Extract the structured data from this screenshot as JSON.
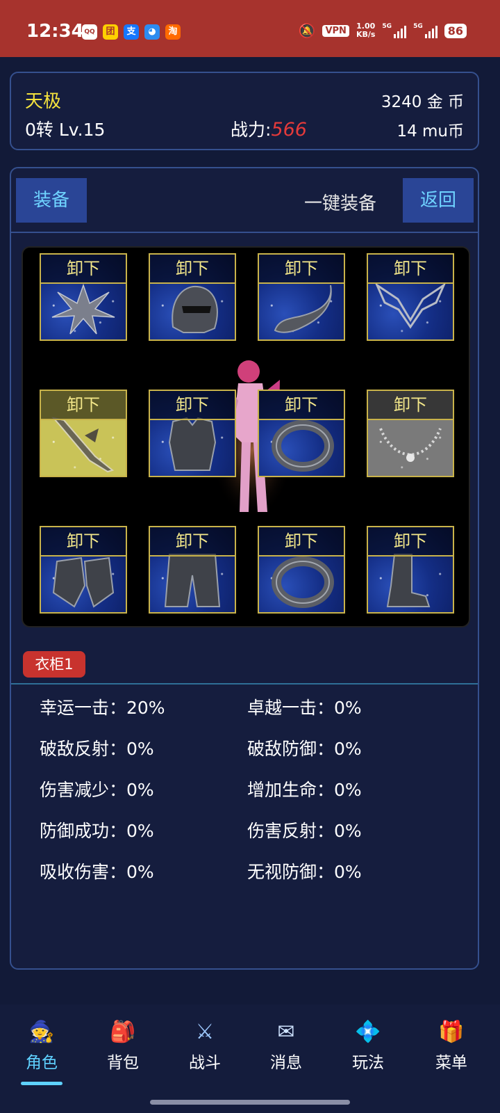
{
  "status_bar": {
    "time": "12:34",
    "app_icons": [
      "QQ",
      "团",
      "支",
      "◕",
      "淘"
    ],
    "vpn": "VPN",
    "speed_top": "1.00",
    "speed_unit": "KB/s",
    "network1": "5G",
    "network2": "5G",
    "battery": "86"
  },
  "player": {
    "name": "天极",
    "level": "0转 Lv.15",
    "power_label": "战力:",
    "power_value": "566",
    "gold": "3240 金  币",
    "mu": "14 mu币"
  },
  "toolbar": {
    "equip_tab": "装备",
    "one_key": "一键装备",
    "back": "返回"
  },
  "slots": [
    {
      "label": "卸下",
      "item": "star-weapon"
    },
    {
      "label": "卸下",
      "item": "helmet"
    },
    {
      "label": "卸下",
      "item": "pendant"
    },
    {
      "label": "卸下",
      "item": "wings"
    },
    {
      "label": "卸下",
      "item": "sword"
    },
    {
      "label": "卸下",
      "item": "armor"
    },
    {
      "label": "卸下",
      "item": "ring"
    },
    {
      "label": "卸下",
      "item": "necklace"
    },
    {
      "label": "卸下",
      "item": "gloves"
    },
    {
      "label": "卸下",
      "item": "pants"
    },
    {
      "label": "卸下",
      "item": "ring"
    },
    {
      "label": "卸下",
      "item": "boots"
    }
  ],
  "wardrobe": "衣柜1",
  "stats": [
    {
      "text": "幸运一击：20%"
    },
    {
      "text": "卓越一击：0%"
    },
    {
      "text": "破敌反射：0%"
    },
    {
      "text": "破敌防御：0%"
    },
    {
      "text": "伤害减少：0%"
    },
    {
      "text": "增加生命：0%"
    },
    {
      "text": "防御成功：0%"
    },
    {
      "text": "伤害反射：0%"
    },
    {
      "text": "吸收伤害：0%"
    },
    {
      "text": "无视防御：0%"
    }
  ],
  "nav": [
    {
      "label": "角色",
      "icon": "🧙"
    },
    {
      "label": "背包",
      "icon": "🎒"
    },
    {
      "label": "战斗",
      "icon": "⚔"
    },
    {
      "label": "消息",
      "icon": "✉"
    },
    {
      "label": "玩法",
      "icon": "💠"
    },
    {
      "label": "菜单",
      "icon": "🎁"
    }
  ],
  "colors": {
    "status_bar": "#a7332d",
    "background": "#121a38",
    "accent_blue": "#5fd1ff",
    "name_yellow": "#f4e23d",
    "power_red": "#e43a3a",
    "slot_border": "#c9b34a"
  }
}
